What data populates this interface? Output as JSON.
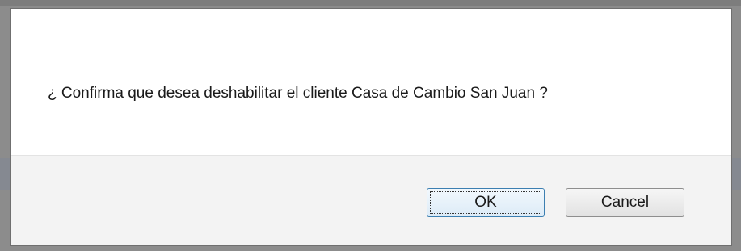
{
  "dialog": {
    "message": "¿ Confirma que desea deshabilitar el cliente Casa de Cambio San Juan ?",
    "ok_label": "OK",
    "cancel_label": "Cancel"
  }
}
